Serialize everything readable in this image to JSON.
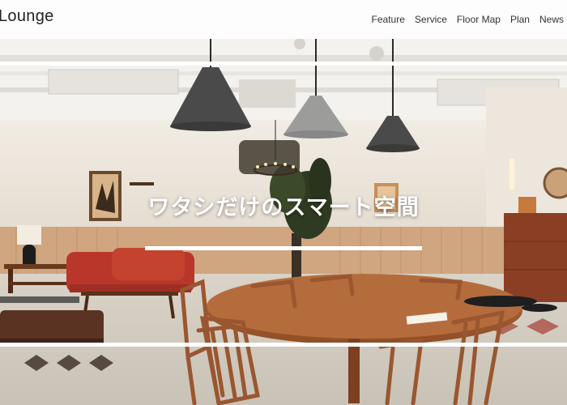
{
  "header": {
    "logo": "Lounge",
    "nav": [
      "Feature",
      "Service",
      "Floor Map",
      "Plan",
      "News"
    ]
  },
  "hero": {
    "headline": "ワタシだけのスマート空間"
  }
}
